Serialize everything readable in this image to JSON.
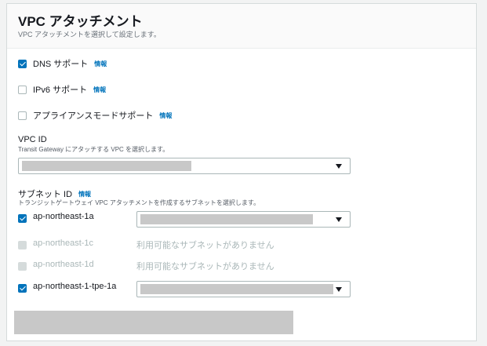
{
  "section": {
    "title": "VPC アタッチメント",
    "description": "VPC アタッチメントを選択して設定します。"
  },
  "options": [
    {
      "label": "DNS サポート",
      "checked": true,
      "info": "情報"
    },
    {
      "label": "IPv6 サポート",
      "checked": false,
      "info": "情報"
    },
    {
      "label": "アプライアンスモードサポート",
      "checked": false,
      "info": "情報"
    }
  ],
  "vpc": {
    "label": "VPC ID",
    "description": "Transit Gateway にアタッチする VPC を選択します。"
  },
  "subnets": {
    "label": "サブネット ID",
    "info": "情報",
    "description": "トランジットゲートウェイ VPC アタッチメントを作成するサブネットを選択します。",
    "zones": [
      {
        "name": "ap-northeast-1a",
        "checked": true,
        "disabled": false,
        "status": ""
      },
      {
        "name": "ap-northeast-1c",
        "checked": false,
        "disabled": true,
        "status": "利用可能なサブネットがありません"
      },
      {
        "name": "ap-northeast-1d",
        "checked": false,
        "disabled": true,
        "status": "利用可能なサブネットがありません"
      },
      {
        "name": "ap-northeast-1-tpe-1a",
        "checked": true,
        "disabled": false,
        "status": ""
      }
    ]
  },
  "colors": {
    "accent": "#0073bb",
    "disabled_text": "#aab7b8",
    "redaction": "#c8c8c8"
  }
}
